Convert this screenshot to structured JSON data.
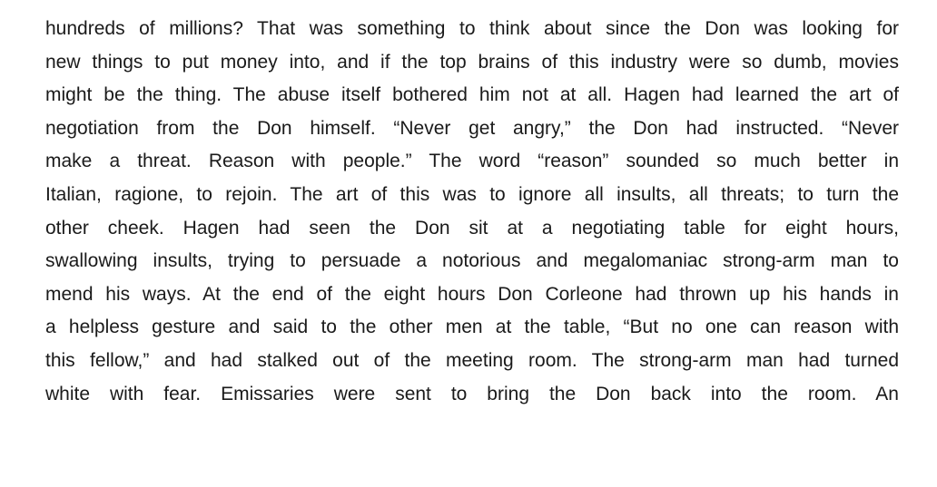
{
  "document": {
    "lines": [
      "hundreds of millions? That was something to think about since the Don was looking for",
      "new things to put money into, and if the top brains of this industry were so dumb, movies",
      "might be the thing. The abuse itself bothered him not at all. Hagen had learned the art of",
      "negotiation from the Don himself. “Never get angry,” the Don had instructed. “Never",
      "make a threat. Reason with people.” The word “reason” sounded so much better in",
      "Italian, ragione, to rejoin. The art of this was to ignore all insults, all threats; to turn the",
      "other cheek. Hagen had seen the Don sit at a negotiating table for eight hours,",
      "swallowing insults, trying to persuade a notorious and megalomaniac strong-arm man to",
      "mend his ways. At the end of the eight hours Don Corleone had thrown up his hands in",
      "a helpless gesture and said to the other men at the table, “But no one can reason with",
      "this fellow,” and had stalked out of the meeting room. The strong-arm man had turned",
      "white with fear. Emissaries were sent to bring the Don back into the room. An"
    ]
  }
}
